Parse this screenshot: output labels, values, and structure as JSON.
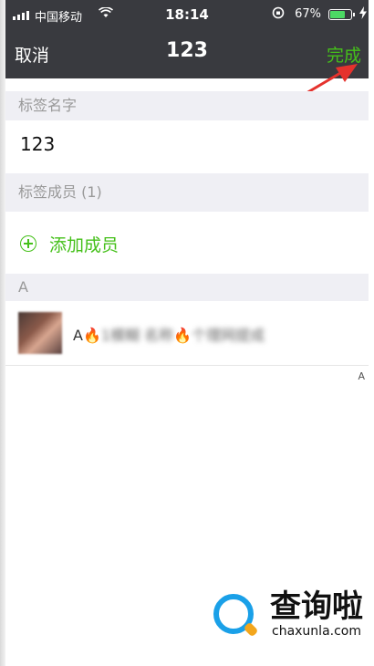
{
  "status_bar": {
    "carrier": "中国移动",
    "time": "18:14",
    "battery": "67%",
    "battery_level": 0.67
  },
  "nav": {
    "cancel": "取消",
    "title": "123",
    "done": "完成"
  },
  "tag_name": {
    "header": "标签名字",
    "value": "123"
  },
  "members": {
    "header": "标签成员 (1)",
    "add": "添加成员",
    "index_section": "A",
    "items": [
      {
        "name_parts": [
          "A",
          "🔥",
          "1",
          "模糊 名称",
          "🔥",
          "个理网提成"
        ]
      }
    ]
  },
  "index_bar": {
    "letter": "A"
  },
  "watermark": {
    "name": "查询啦",
    "domain": "chaxunla.com"
  },
  "colors": {
    "accent": "#45c01a",
    "nav_bg": "#393a3f",
    "section_bg": "#efeff4",
    "arrow": "#e5322d"
  }
}
